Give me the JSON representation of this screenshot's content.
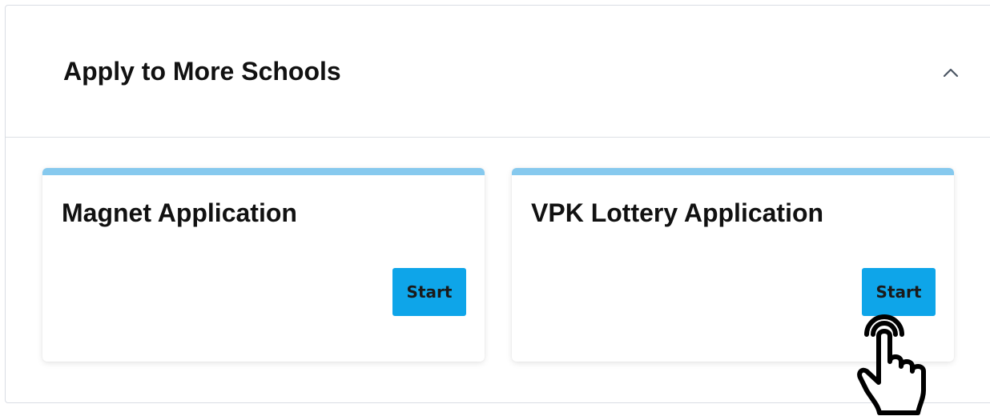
{
  "section": {
    "title": "Apply to More Schools",
    "toggle_icon": "chevron-up-icon"
  },
  "cards": [
    {
      "title": "Magnet Application",
      "button_label": "Start"
    },
    {
      "title": "VPK Lottery Application",
      "button_label": "Start"
    }
  ],
  "cursor": {
    "icon": "pointer-hand-icon"
  },
  "colors": {
    "accent_bar": "#86c9ee",
    "button": "#0ea5e9",
    "border": "#d9dde3"
  }
}
